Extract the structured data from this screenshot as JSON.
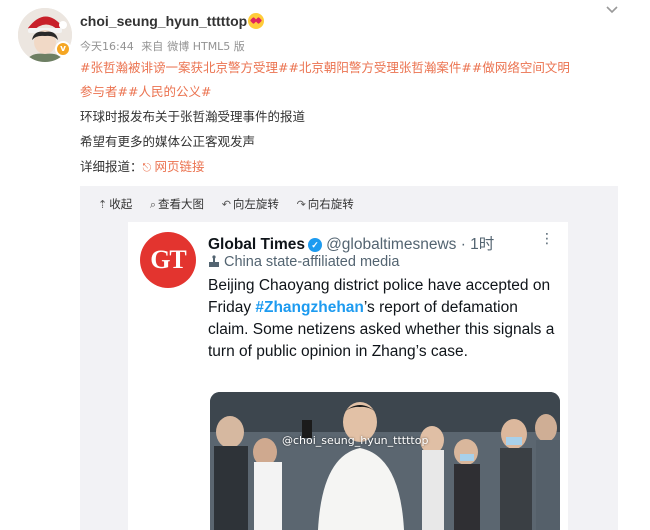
{
  "post": {
    "username": "choi_seung_hyun_tttttop",
    "time": "今天16:44",
    "source_prefix": "来自",
    "source": "微博 HTML5 版",
    "line1": {
      "tags": [
        "#张哲瀚被诽谤一案获北京警方受理#",
        "#北京朝阳警方受理张哲瀚案件#",
        "#做网络空间文明"
      ]
    },
    "line2": {
      "tags": [
        "参与者#",
        "#人民的公义#"
      ]
    },
    "line3": "环球时报发布关于张哲瀚受理事件的报道",
    "line4": "希望有更多的媒体公正客观发声",
    "line5_label": "详细报道：",
    "line5_link": "网页链接"
  },
  "toolbar": {
    "collapse": "收起",
    "view_large": "查看大图",
    "rotate_left": "向左旋转",
    "rotate_right": "向右旋转"
  },
  "tweet": {
    "logo_text": "GT",
    "name": "Global Times",
    "handle_time": "@globaltimesnews · 1时",
    "affiliation": "China state-affiliated media",
    "body_part1": "Beijing Chaoyang district police have accepted on Friday ",
    "hashtag": "#Zhangzhehan",
    "body_part2": "’s report of defamation claim. Some netizens asked whether this signals a turn of public opinion in Zhang’s case."
  },
  "watermark": "@choi_seung_hyun_tttttop",
  "icons": {
    "verified_badge": "v-badge-icon",
    "emoji": "heart-eyes-emoji-icon",
    "more_menu": "chevron-down-icon",
    "link": "link-icon",
    "collapse": "collapse-icon",
    "view_large": "search-icon",
    "rotate_left": "rotate-left-icon",
    "rotate_right": "rotate-right-icon",
    "twitter_verified": "verified-check-icon",
    "affiliation": "podium-icon"
  },
  "colors": {
    "tag_orange": "#eb7350",
    "twitter_blue": "#1d9bf0",
    "gt_red": "#e3342f",
    "badge_yellow": "#f5a623"
  }
}
